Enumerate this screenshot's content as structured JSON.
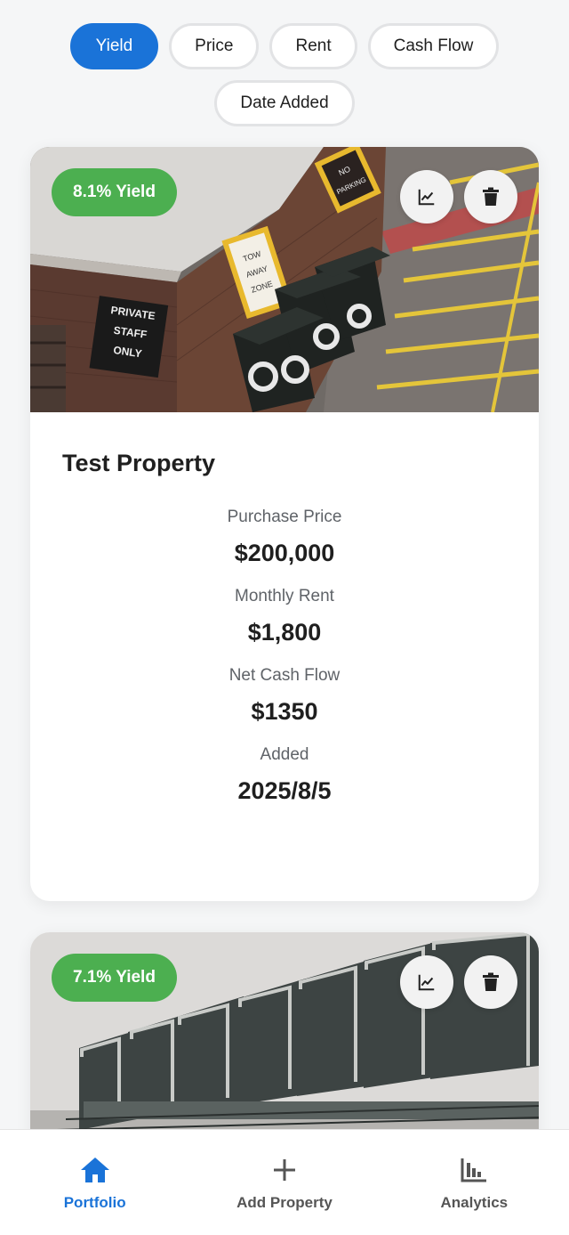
{
  "filters": {
    "chips": [
      {
        "label": "Yield",
        "active": true
      },
      {
        "label": "Price",
        "active": false
      },
      {
        "label": "Rent",
        "active": false
      },
      {
        "label": "Cash Flow",
        "active": false
      },
      {
        "label": "Date Added",
        "active": false
      }
    ]
  },
  "properties": [
    {
      "yield_badge": "8.1% Yield",
      "name": "Test Property",
      "stats": [
        {
          "label": "Purchase Price",
          "value": "$200,000"
        },
        {
          "label": "Monthly Rent",
          "value": "$1,800"
        },
        {
          "label": "Net Cash Flow",
          "value": "$1350"
        },
        {
          "label": "Added",
          "value": "2025/8/5"
        }
      ],
      "photo_signs": [
        "PRIVATE",
        "STAFF",
        "ONLY",
        "TOW",
        "AWAY",
        "ZONE",
        "NO",
        "PARKING"
      ]
    },
    {
      "yield_badge": "7.1% Yield"
    }
  ],
  "nav": {
    "items": [
      {
        "label": "Portfolio",
        "icon": "home-icon",
        "active": true
      },
      {
        "label": "Add Property",
        "icon": "plus-icon",
        "active": false
      },
      {
        "label": "Analytics",
        "icon": "bar-chart-icon",
        "active": false
      }
    ]
  },
  "colors": {
    "accent": "#1a73d8",
    "yield_badge": "#4caf50"
  }
}
